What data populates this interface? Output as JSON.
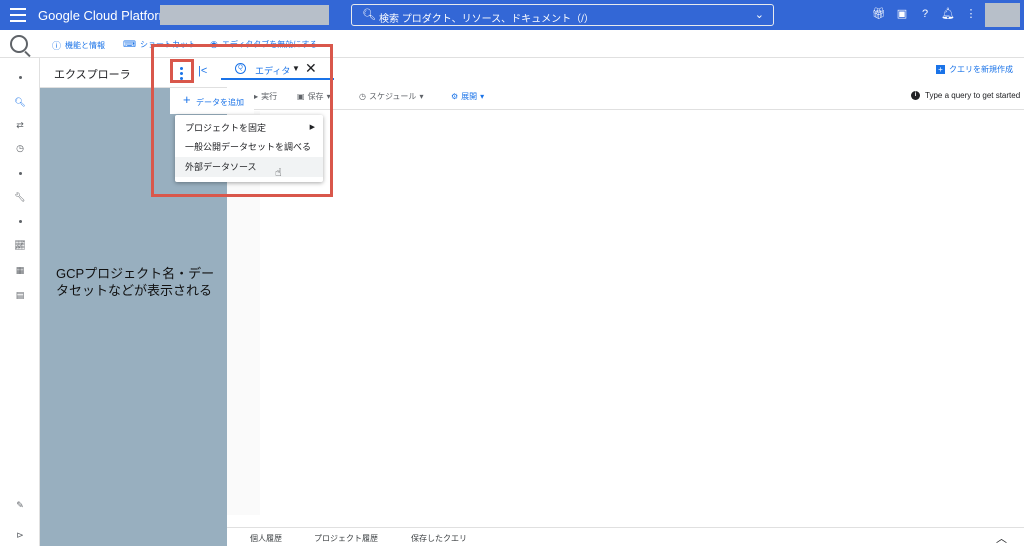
{
  "topbar": {
    "brand": "Google Cloud Platform",
    "search_placeholder": "検索  プロダクト、リソース、ドキュメント（/）",
    "bg_color": "#3367d6"
  },
  "subbar": {
    "links": [
      {
        "icon": "info-icon",
        "label": "機能と情報"
      },
      {
        "icon": "keyboard-icon",
        "label": "ショートカット"
      },
      {
        "icon": "eye-off-icon",
        "label": "エディタタブを無効にする"
      }
    ]
  },
  "explorer": {
    "title": "エクスプローラ",
    "overlay_text": "GCPプロジェクト名・データセットなどが表示される"
  },
  "editor_tab": {
    "label": "エディタ"
  },
  "new_query": "クエリを新規作成",
  "toolbar": {
    "run": "実行",
    "save": "保存",
    "schedule": "スケジュール",
    "expand": "展開"
  },
  "hint": "Type a query to get started",
  "menu": {
    "add_data": "データを追加",
    "items": [
      {
        "label": "プロジェクトを固定",
        "has_submenu": true
      },
      {
        "label": "一般公開データセットを調べる",
        "has_submenu": false
      },
      {
        "label": "外部データソース",
        "has_submenu": false,
        "hovered": true
      }
    ]
  },
  "bottom_tabs": [
    "個人履歴",
    "プロジェクト履歴",
    "保存したクエリ"
  ],
  "colors": {
    "accent": "#1a73e8",
    "explorer_bg": "#98afbf",
    "highlight": "#d9574b"
  }
}
